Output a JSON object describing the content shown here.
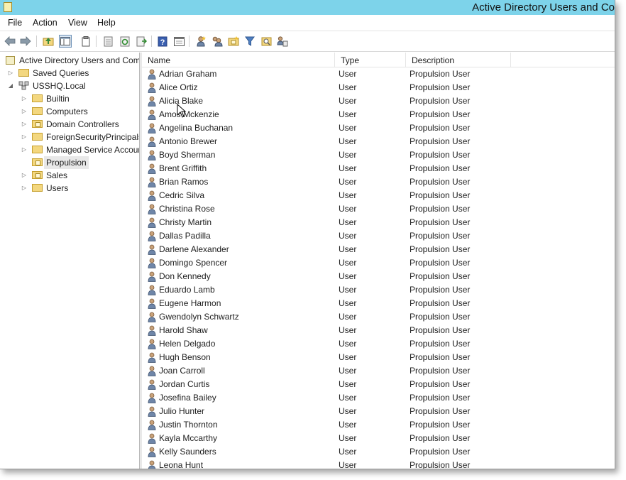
{
  "window": {
    "title": "Active Directory Users and Co"
  },
  "menu": [
    "File",
    "Action",
    "View",
    "Help"
  ],
  "toolbar": {
    "icons": [
      "back-arrow-icon",
      "forward-arrow-icon",
      "up-folder-icon",
      "console-tree-icon",
      "clipboard-icon",
      "properties-icon",
      "refresh-icon",
      "export-list-icon",
      "help-icon",
      "console-icon",
      "new-user-icon",
      "new-group-icon",
      "new-ou-icon",
      "filter-icon",
      "find-icon",
      "delegate-icon"
    ]
  },
  "tree": {
    "root": "Active Directory Users and Com",
    "items": [
      {
        "label": "Saved Queries",
        "level": 1,
        "arrow": "▷",
        "icon": "folder"
      },
      {
        "label": "USSHQ.Local",
        "level": 1,
        "arrow": "◢",
        "icon": "domain"
      },
      {
        "label": "Builtin",
        "level": 2,
        "arrow": "▷",
        "icon": "folder"
      },
      {
        "label": "Computers",
        "level": 2,
        "arrow": "▷",
        "icon": "folder"
      },
      {
        "label": "Domain Controllers",
        "level": 2,
        "arrow": "▷",
        "icon": "ou"
      },
      {
        "label": "ForeignSecurityPrincipals",
        "level": 2,
        "arrow": "▷",
        "icon": "folder"
      },
      {
        "label": "Managed Service Accounts",
        "level": 2,
        "arrow": "▷",
        "icon": "folder"
      },
      {
        "label": "Propulsion",
        "level": 2,
        "arrow": "",
        "icon": "ou",
        "selected": true
      },
      {
        "label": "Sales",
        "level": 2,
        "arrow": "▷",
        "icon": "ou"
      },
      {
        "label": "Users",
        "level": 2,
        "arrow": "▷",
        "icon": "folder"
      }
    ]
  },
  "list": {
    "columns": [
      "Name",
      "Type",
      "Description"
    ],
    "rows": [
      {
        "name": "Adrian Graham",
        "type": "User",
        "description": "Propulsion User"
      },
      {
        "name": "Alice Ortiz",
        "type": "User",
        "description": "Propulsion User"
      },
      {
        "name": "Alicia Blake",
        "type": "User",
        "description": "Propulsion User"
      },
      {
        "name": "Amos Mckenzie",
        "type": "User",
        "description": "Propulsion User"
      },
      {
        "name": "Angelina Buchanan",
        "type": "User",
        "description": "Propulsion User"
      },
      {
        "name": "Antonio Brewer",
        "type": "User",
        "description": "Propulsion User"
      },
      {
        "name": "Boyd Sherman",
        "type": "User",
        "description": "Propulsion User"
      },
      {
        "name": "Brent Griffith",
        "type": "User",
        "description": "Propulsion User"
      },
      {
        "name": "Brian Ramos",
        "type": "User",
        "description": "Propulsion User"
      },
      {
        "name": "Cedric Silva",
        "type": "User",
        "description": "Propulsion User"
      },
      {
        "name": "Christina Rose",
        "type": "User",
        "description": "Propulsion User"
      },
      {
        "name": "Christy Martin",
        "type": "User",
        "description": "Propulsion User"
      },
      {
        "name": "Dallas Padilla",
        "type": "User",
        "description": "Propulsion User"
      },
      {
        "name": "Darlene Alexander",
        "type": "User",
        "description": "Propulsion User"
      },
      {
        "name": "Domingo Spencer",
        "type": "User",
        "description": "Propulsion User"
      },
      {
        "name": "Don Kennedy",
        "type": "User",
        "description": "Propulsion User"
      },
      {
        "name": "Eduardo Lamb",
        "type": "User",
        "description": "Propulsion User"
      },
      {
        "name": "Eugene Harmon",
        "type": "User",
        "description": "Propulsion User"
      },
      {
        "name": "Gwendolyn Schwartz",
        "type": "User",
        "description": "Propulsion User"
      },
      {
        "name": "Harold Shaw",
        "type": "User",
        "description": "Propulsion User"
      },
      {
        "name": "Helen Delgado",
        "type": "User",
        "description": "Propulsion User"
      },
      {
        "name": "Hugh Benson",
        "type": "User",
        "description": "Propulsion User"
      },
      {
        "name": "Joan Carroll",
        "type": "User",
        "description": "Propulsion User"
      },
      {
        "name": "Jordan Curtis",
        "type": "User",
        "description": "Propulsion User"
      },
      {
        "name": "Josefina Bailey",
        "type": "User",
        "description": "Propulsion User"
      },
      {
        "name": "Julio Hunter",
        "type": "User",
        "description": "Propulsion User"
      },
      {
        "name": "Justin Thornton",
        "type": "User",
        "description": "Propulsion User"
      },
      {
        "name": "Kayla Mccarthy",
        "type": "User",
        "description": "Propulsion User"
      },
      {
        "name": "Kelly Saunders",
        "type": "User",
        "description": "Propulsion User"
      },
      {
        "name": "Leona Hunt",
        "type": "User",
        "description": "Propulsion User"
      }
    ]
  },
  "colors": {
    "titlebar": "#7dd3ea",
    "folder": "#f3d77f",
    "selected": "#e8e8e8"
  }
}
